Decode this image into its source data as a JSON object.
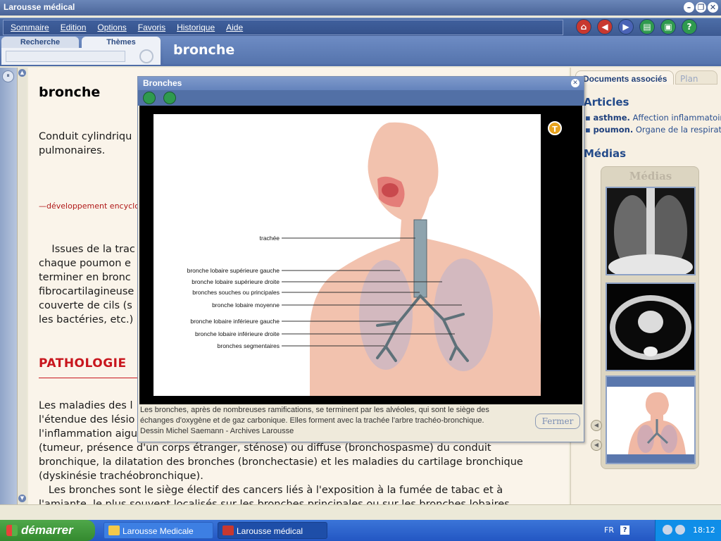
{
  "window": {
    "title": "Larousse médical"
  },
  "menu": [
    "Sommaire",
    "Edition",
    "Options",
    "Favoris",
    "Historique",
    "Aide"
  ],
  "search_tabs": {
    "recherche": "Recherche",
    "themes": "Thèmes"
  },
  "heading": "bronche",
  "article": {
    "title": "bronche",
    "intro_lines": [
      "Conduit cylindriqu",
      "pulmonaires."
    ],
    "dev_link": "—développement encyclope",
    "para1_lines": [
      "    Issues de la trac",
      "chaque poumon e",
      "terminer en bronc",
      "fibrocartilagineuse",
      "couverte de cils (s",
      "les bactéries, etc.)"
    ],
    "section": "PATHOLOGIE",
    "para2_lines": [
      "Les maladies des l",
      "l'étendue des lésio",
      "l'inflammation aigu",
      "(tumeur, présence d'un corps étranger, sténose) ou diffuse (bronchospasme) du conduit",
      "bronchique, la dilatation des bronches (bronchectasie) et les maladies du cartilage bronchique",
      "(dyskinésie trachéobronchique).",
      "   Les bronches sont le siège électif des cancers liés à l'exposition à la fumée de tabac et à",
      "l'amiante, le plus souvent localisés sur les bronches principales ou sur les bronches lobaires"
    ]
  },
  "right_panel": {
    "tab_docs": "Documents associés",
    "tab_plan": "Plan",
    "articles_heading": "Articles",
    "articles": [
      {
        "term": "asthme.",
        "desc": "Affection inflammatoire"
      },
      {
        "term": "poumon.",
        "desc": "Organe de la respiratio"
      }
    ],
    "medias_heading": "Médias",
    "media_box_title": "Médias"
  },
  "popup": {
    "title": "Bronches",
    "labels": [
      "trachée",
      "bronche lobaire supérieure gauche",
      "bronche lobaire supérieure droite",
      "bronches souches ou principales",
      "bronche lobaire moyenne",
      "bronche lobaire inférieure gauche",
      "bronche lobaire inférieure droite",
      "bronches segmentaires"
    ],
    "caption_lines": [
      "Les bronches, après de nombreuses ramifications, se terminent par les alvéoles, qui sont le siège des",
      "échanges d'oxygène et de gaz carbonique. Elles forment avec la trachée l'arbre trachéo-bronchique.",
      "Dessin Michel Saemann - Archives Larousse"
    ],
    "close_button": "Fermer"
  },
  "taskbar": {
    "start": "démarrer",
    "tasks": [
      "Larousse Medicale",
      "Larousse médical"
    ],
    "lang": "FR",
    "clock": "18:12"
  },
  "colors": {
    "accent": "#4e6ca6",
    "section_red": "#c8161e",
    "article_bg": "#faf4ea"
  }
}
